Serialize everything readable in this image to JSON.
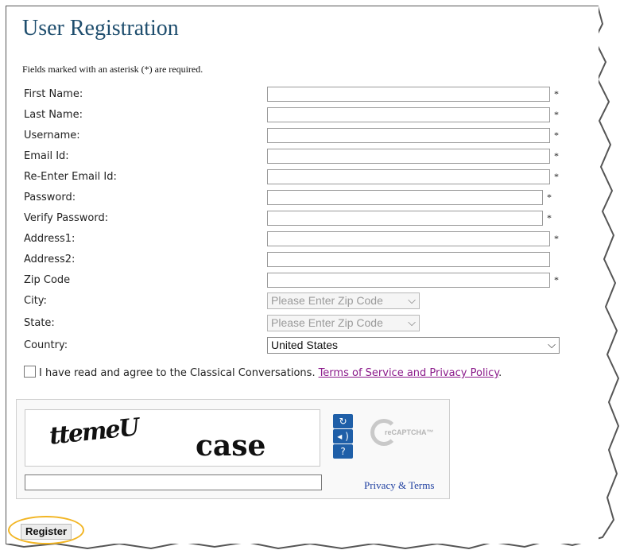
{
  "page": {
    "title": "User Registration",
    "required_note": "Fields marked with an asterisk (*) are required."
  },
  "fields": [
    {
      "label": "First Name:",
      "value": "",
      "required_mark": "*"
    },
    {
      "label": "Last Name:",
      "value": "",
      "required_mark": "*"
    },
    {
      "label": "Username:",
      "value": "",
      "required_mark": "*"
    },
    {
      "label": "Email Id:",
      "value": "",
      "required_mark": "*"
    },
    {
      "label": "Re-Enter Email Id:",
      "value": "",
      "required_mark": "*"
    },
    {
      "label": "Password:",
      "value": "",
      "required_mark": "*"
    },
    {
      "label": "Verify Password:",
      "value": "",
      "required_mark": "*"
    },
    {
      "label": "Address1:",
      "value": "",
      "required_mark": "*"
    },
    {
      "label": "Address2:",
      "value": "",
      "required_mark": ""
    },
    {
      "label": "Zip Code",
      "value": "",
      "required_mark": "*"
    }
  ],
  "selects": {
    "city": {
      "label": "City:",
      "selected": "Please Enter Zip Code"
    },
    "state": {
      "label": "State:",
      "selected": "Please Enter Zip Code"
    },
    "country": {
      "label": "Country:",
      "selected": "United States"
    }
  },
  "agreement": {
    "checked": false,
    "text": "I have read and agree to the Classical Conversations.",
    "link_text": "Terms of Service and Privacy Policy",
    "trailing": "."
  },
  "captcha": {
    "word1": "ttemeU",
    "word2": "case",
    "input_value": "",
    "buttons": [
      "reload-icon",
      "audio-icon",
      "help-icon"
    ],
    "brand": "reCAPTCHA™",
    "privacy_link": "Privacy & Terms"
  },
  "actions": {
    "register_label": "Register"
  },
  "colors": {
    "title": "#1f4e6e",
    "link_terms": "#8b1a8b",
    "link_privacy": "#1f3fa0",
    "captcha_buttons": "#1f5fa8",
    "highlight_ring": "#f2b523"
  }
}
